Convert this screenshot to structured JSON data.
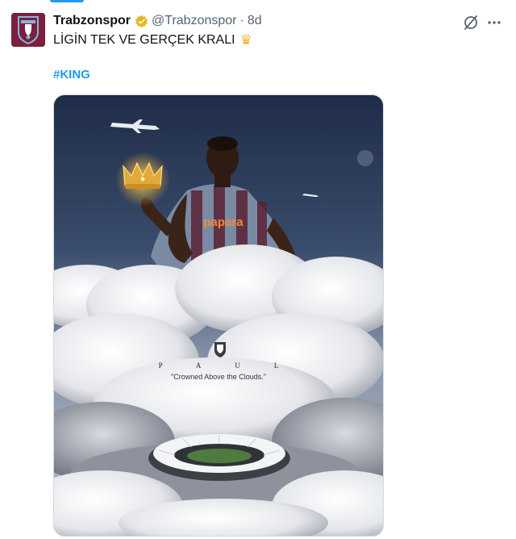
{
  "tweet": {
    "display_name": "Trabzonspor",
    "handle": "@Trabzonspor",
    "separator": "·",
    "time": "8d",
    "text": "LİGİN TEK VE GERÇEK KRALI",
    "emoji": "♛",
    "hashtag": "#KING"
  },
  "media": {
    "jersey_sponsor": "papara",
    "initials": "PAUL",
    "quote": "\"Crowned Above the Clouds.\""
  },
  "icons": {
    "verified": "verified-badge-icon",
    "grok": "grok-icon",
    "more": "more-icon"
  },
  "colors": {
    "accent": "#1d9bf0",
    "verified": "#e2b719",
    "club_maroon": "#7a1f3d",
    "club_blue": "#86b5dc"
  }
}
